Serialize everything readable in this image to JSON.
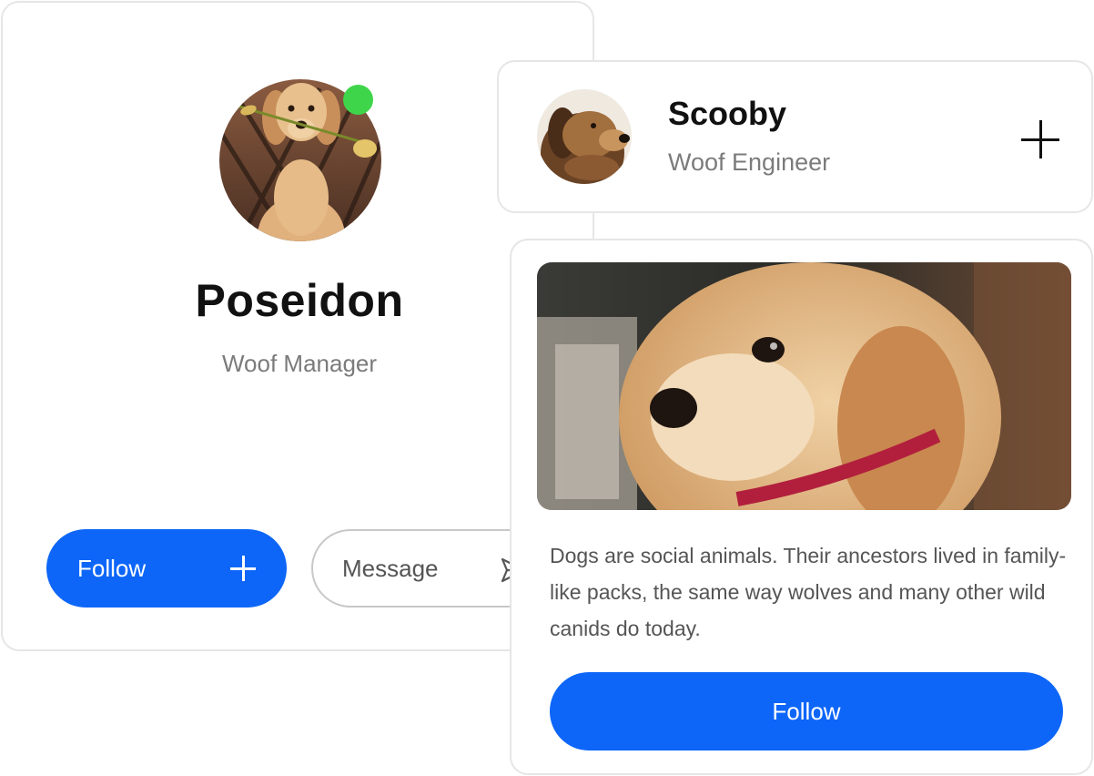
{
  "colors": {
    "accent": "#0d66f8",
    "online": "#3fd54a",
    "text_primary": "#111111",
    "text_secondary": "#7b7b7b",
    "border": "#e6e6e6"
  },
  "profile_card": {
    "name": "Poseidon",
    "role": "Woof Manager",
    "online": true,
    "follow_label": "Follow",
    "follow_icon": "plus-icon",
    "message_label": "Message",
    "message_icon": "send-icon"
  },
  "mini_card": {
    "name": "Scooby",
    "role": "Woof Engineer",
    "action_icon": "plus-icon"
  },
  "post_card": {
    "description": "Dogs are social animals. Their ancestors lived in family-like packs, the same way wolves and many other wild canids do today.",
    "follow_label": "Follow"
  }
}
